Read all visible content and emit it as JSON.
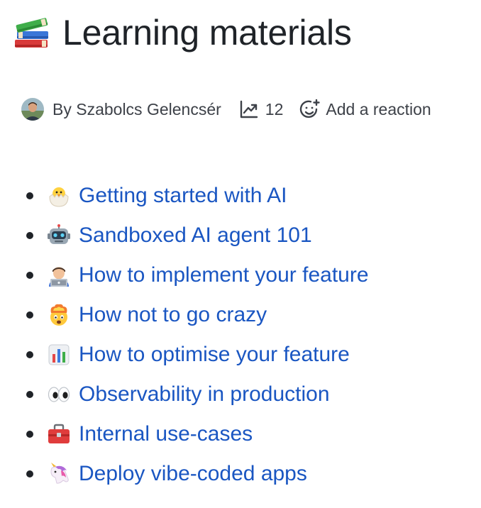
{
  "page": {
    "title": "Learning materials",
    "title_icon": "books-icon"
  },
  "meta": {
    "author": "By Szabolcs Gelencsér",
    "views_icon": "trending-up-icon",
    "views": "12",
    "reaction_icon": "add-reaction-icon",
    "reaction_label": "Add a reaction"
  },
  "colors": {
    "link": "#1a56c2",
    "text": "#1f2328",
    "muted": "#3d4148"
  },
  "materials": [
    {
      "icon": "hatching-chick-icon",
      "label": "Getting started with AI"
    },
    {
      "icon": "robot-icon",
      "label": "Sandboxed AI agent 101"
    },
    {
      "icon": "technologist-icon",
      "label": "How to implement your feature"
    },
    {
      "icon": "exploding-head-icon",
      "label": "How not to go crazy"
    },
    {
      "icon": "bar-chart-icon",
      "label": "How to optimise your feature"
    },
    {
      "icon": "eyes-icon",
      "label": "Observability in production"
    },
    {
      "icon": "toolbox-icon",
      "label": "Internal use-cases"
    },
    {
      "icon": "unicorn-icon",
      "label": "Deploy vibe-coded apps"
    }
  ]
}
